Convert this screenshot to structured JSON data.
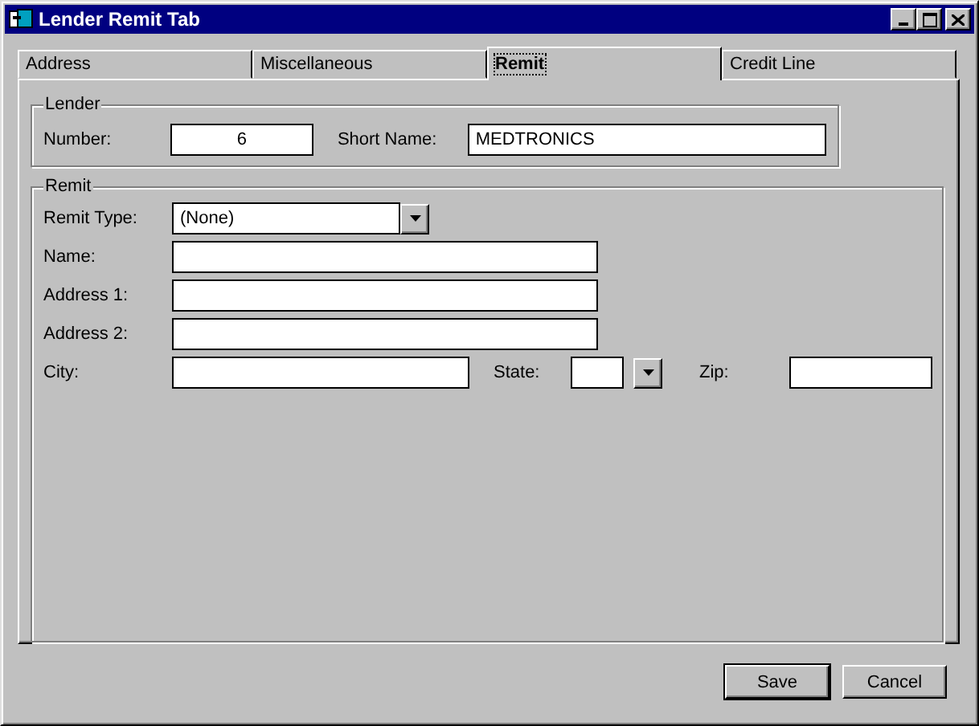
{
  "window": {
    "title": "Lender Remit Tab"
  },
  "tabs": [
    {
      "label": "Address",
      "selected": false
    },
    {
      "label": "Miscellaneous",
      "selected": false
    },
    {
      "label": "Remit",
      "selected": true
    },
    {
      "label": "Credit Line",
      "selected": false
    }
  ],
  "lender": {
    "title": "Lender",
    "number": {
      "label": "Number:",
      "value": "6"
    },
    "short_name": {
      "label": "Short Name:",
      "value": "MEDTRONICS"
    }
  },
  "remit": {
    "title": "Remit",
    "remit_type": {
      "label": "Remit Type:",
      "value": "(None)"
    },
    "name": {
      "label": "Name:"
    },
    "address_1": {
      "label": "Address 1:"
    },
    "address_2": {
      "label": "Address 2:"
    },
    "city": {
      "label": "City:"
    },
    "state": {
      "label": "State:"
    },
    "zip": {
      "label": "Zip:"
    }
  },
  "buttons": [
    "Save",
    "Cancel"
  ]
}
